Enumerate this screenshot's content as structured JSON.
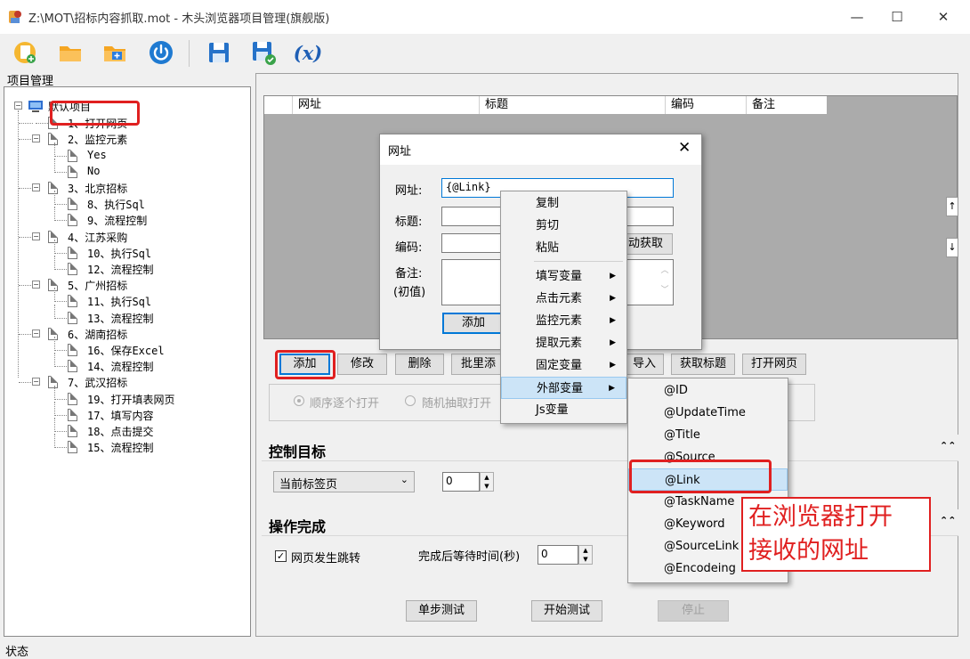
{
  "window": {
    "title": "Z:\\MOT\\招标内容抓取.mot - 木头浏览器项目管理(旗舰版)",
    "minimize": "—",
    "maximize": "☐",
    "close": "✕"
  },
  "toolbar": {
    "icons": [
      "new-file-icon",
      "open-folder-icon",
      "add-folder-icon",
      "power-icon",
      "save-icon",
      "save-as-icon",
      "variable-icon"
    ],
    "variable_label": "(x)"
  },
  "tree": {
    "panel_label": "项目管理",
    "root": "默认项目",
    "nodes": [
      {
        "label": "1、打开网页",
        "depth": 1
      },
      {
        "label": "2、监控元素",
        "depth": 1
      },
      {
        "label": "Yes",
        "depth": 2
      },
      {
        "label": "No",
        "depth": 2
      },
      {
        "label": "3、北京招标",
        "depth": 1
      },
      {
        "label": "8、执行Sql",
        "depth": 2
      },
      {
        "label": "9、流程控制",
        "depth": 2
      },
      {
        "label": "4、江苏采购",
        "depth": 1
      },
      {
        "label": "10、执行Sql",
        "depth": 2
      },
      {
        "label": "12、流程控制",
        "depth": 2
      },
      {
        "label": "5、广州招标",
        "depth": 1
      },
      {
        "label": "11、执行Sql",
        "depth": 2
      },
      {
        "label": "13、流程控制",
        "depth": 2
      },
      {
        "label": "6、湖南招标",
        "depth": 1
      },
      {
        "label": "16、保存Excel",
        "depth": 2
      },
      {
        "label": "14、流程控制",
        "depth": 2
      },
      {
        "label": "7、武汉招标",
        "depth": 1
      },
      {
        "label": "19、打开填表网页",
        "depth": 2
      },
      {
        "label": "17、填写内容",
        "depth": 2
      },
      {
        "label": "18、点击提交",
        "depth": 2
      },
      {
        "label": "15、流程控制",
        "depth": 2
      }
    ]
  },
  "grid": {
    "columns": [
      "网址",
      "标题",
      "编码",
      "备注"
    ]
  },
  "url_buttons": {
    "add": "添加",
    "edit": "修改",
    "delete": "删除",
    "batch_add": "批里添",
    "import": "导入",
    "get_title": "获取标题",
    "open_page": "打开网页"
  },
  "open_mode": {
    "sequential": "顺序逐个打开",
    "random": "随机抽取打开"
  },
  "control_target": {
    "title": "控制目标",
    "tab_select": "当前标签页",
    "tab_index": "0"
  },
  "completion": {
    "title": "操作完成",
    "page_jump_label": "网页发生跳转",
    "page_jump_checked": true,
    "wait_label": "完成后等待时间(秒)",
    "wait_value": "0"
  },
  "test_buttons": {
    "step": "单步测试",
    "start": "开始测试",
    "stop": "停止"
  },
  "dialog": {
    "title": "网址",
    "url_label": "网址:",
    "url_value": "{@Link}",
    "title_label": "标题:",
    "code_label": "编码:",
    "auto_get": "动获取",
    "note_label": "备注:",
    "note_hint": "(初值)",
    "add_button": "添加"
  },
  "context_menu": {
    "items": [
      {
        "label": "复制",
        "submenu": false
      },
      {
        "label": "剪切",
        "submenu": false
      },
      {
        "label": "粘贴",
        "submenu": false
      },
      {
        "label": "填写变量",
        "submenu": true
      },
      {
        "label": "点击元素",
        "submenu": true
      },
      {
        "label": "监控元素",
        "submenu": true
      },
      {
        "label": "提取元素",
        "submenu": true
      },
      {
        "label": "固定变量",
        "submenu": true
      },
      {
        "label": "外部变量",
        "submenu": true,
        "highlighted": true
      },
      {
        "label": "Js变量",
        "submenu": false
      }
    ]
  },
  "submenu": {
    "items": [
      "@ID",
      "@UpdateTime",
      "@Title",
      "@Source",
      "@Link",
      "@TaskName",
      "@Keyword",
      "@SourceLink",
      "@Encodeing"
    ],
    "highlighted": "@Link"
  },
  "annotation": {
    "line1": "在浏览器打开",
    "line2": "接收的网址"
  },
  "status": {
    "label": "状态"
  },
  "colors": {
    "highlight_red": "#e02020",
    "menu_highlight": "#cce4f7",
    "grid_bg": "#ababab"
  }
}
